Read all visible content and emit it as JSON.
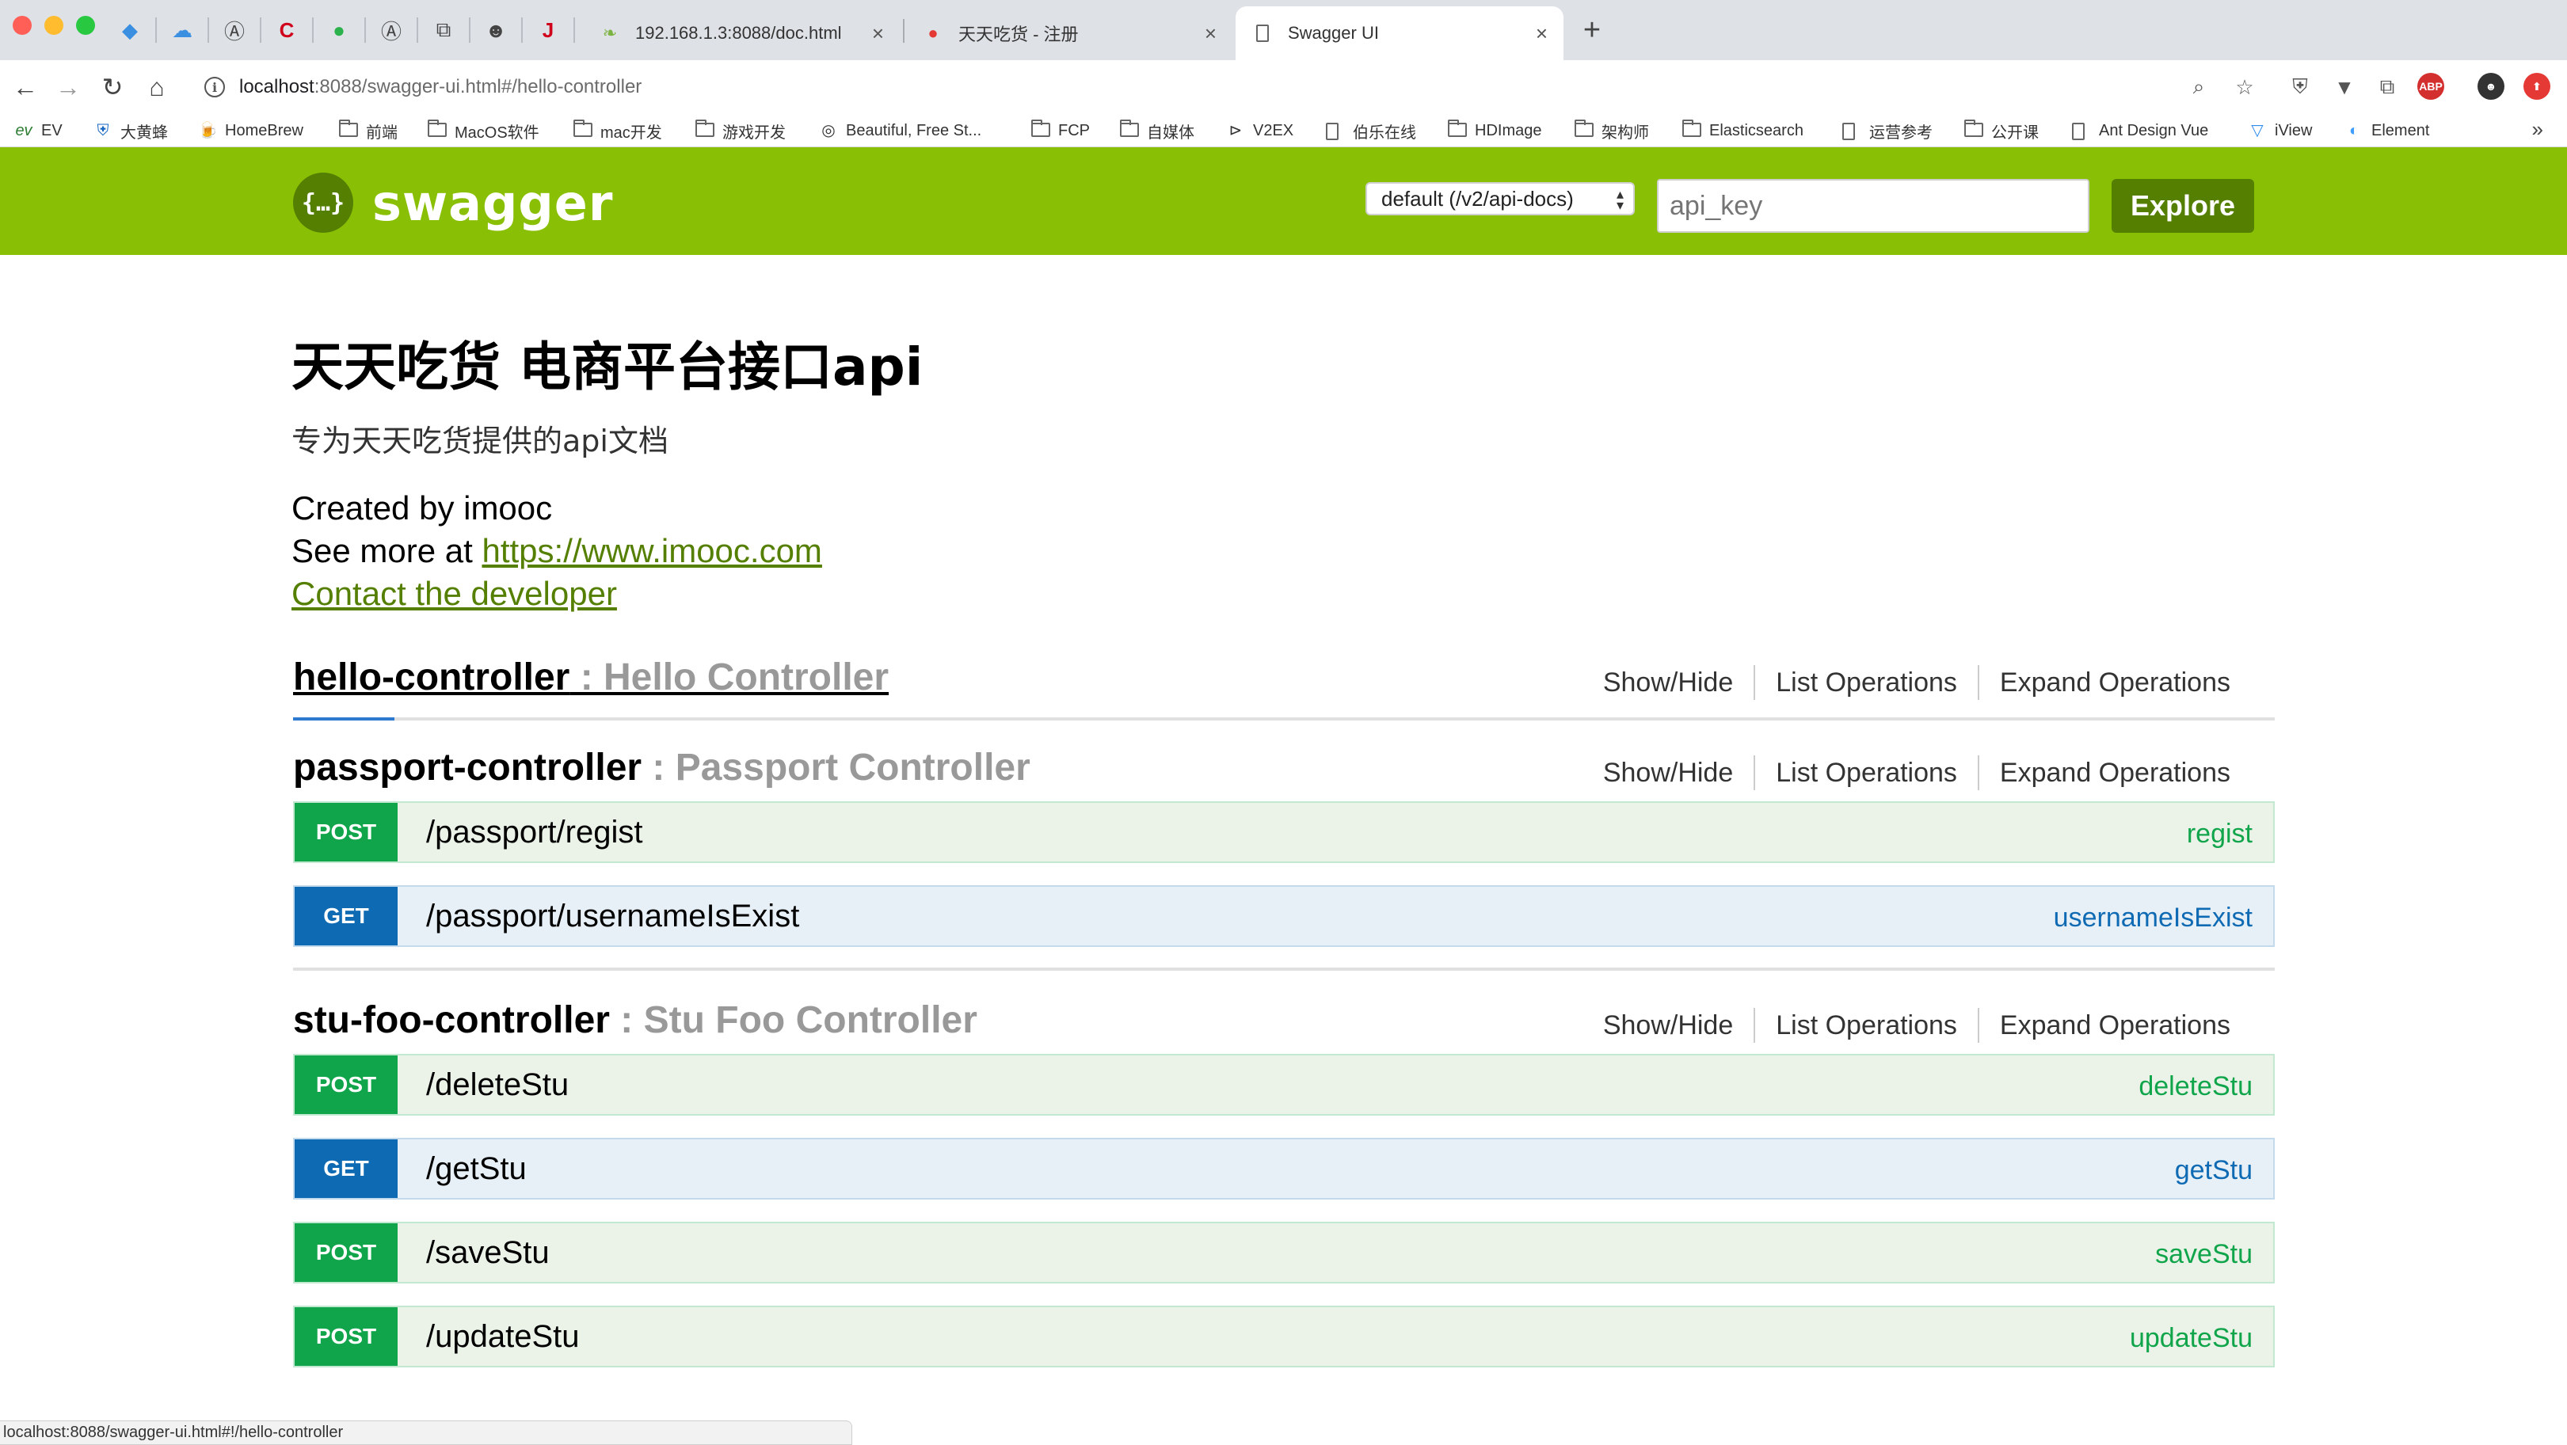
{
  "browser": {
    "tabs": [
      {
        "title": "192.168.1.3:8088/doc.html",
        "active": false
      },
      {
        "title": "天天吃货 - 注册",
        "active": false
      },
      {
        "title": "Swagger UI",
        "active": true
      }
    ],
    "url_host": "localhost",
    "url_path": ":8088/swagger-ui.html#/hello-controller",
    "bookmarks": [
      {
        "label": "EV",
        "icon": "ev-icon"
      },
      {
        "label": "大黄蜂",
        "icon": "shield-icon"
      },
      {
        "label": "HomeBrew",
        "icon": "beer-icon"
      },
      {
        "label": "前端",
        "icon": "folder-icon"
      },
      {
        "label": "MacOS软件",
        "icon": "folder-icon"
      },
      {
        "label": "mac开发",
        "icon": "folder-icon"
      },
      {
        "label": "游戏开发",
        "icon": "folder-icon"
      },
      {
        "label": "Beautiful, Free St...",
        "icon": "target-icon"
      },
      {
        "label": "FCP",
        "icon": "folder-icon"
      },
      {
        "label": "自媒体",
        "icon": "folder-icon"
      },
      {
        "label": "V2EX",
        "icon": "v2ex-icon"
      },
      {
        "label": "伯乐在线",
        "icon": "page-icon"
      },
      {
        "label": "HDImage",
        "icon": "folder-icon"
      },
      {
        "label": "架构师",
        "icon": "folder-icon"
      },
      {
        "label": "Elasticsearch",
        "icon": "folder-icon"
      },
      {
        "label": "运营参考",
        "icon": "page-icon"
      },
      {
        "label": "公开课",
        "icon": "folder-icon"
      },
      {
        "label": "Ant Design Vue",
        "icon": "page-icon"
      },
      {
        "label": "iView",
        "icon": "iview-icon"
      },
      {
        "label": "Element",
        "icon": "element-icon"
      }
    ],
    "status_url": "localhost:8088/swagger-ui.html#!/hello-controller"
  },
  "header": {
    "logo_text": "swagger",
    "spec_select": "default (/v2/api-docs)",
    "api_key_placeholder": "api_key",
    "explore_label": "Explore",
    "brand_color": "#89bf04"
  },
  "info": {
    "title": "天天吃货 电商平台接口api",
    "description": "专为天天吃货提供的api文档",
    "created_by": "Created by imooc",
    "see_more_prefix": "See more at ",
    "see_more_link": "https://www.imooc.com",
    "contact": "Contact the developer"
  },
  "actions": {
    "show_hide": "Show/Hide",
    "list_operations": "List Operations",
    "expand_operations": "Expand Operations"
  },
  "resources": [
    {
      "name": "hello-controller",
      "description": " : Hello Controller",
      "operations": []
    },
    {
      "name": "passport-controller",
      "description": " : Passport Controller",
      "operations": [
        {
          "method": "POST",
          "path": "/passport/regist",
          "nickname": "regist"
        },
        {
          "method": "GET",
          "path": "/passport/usernameIsExist",
          "nickname": "usernameIsExist"
        }
      ]
    },
    {
      "name": "stu-foo-controller",
      "description": " : Stu Foo Controller",
      "operations": [
        {
          "method": "POST",
          "path": "/deleteStu",
          "nickname": "deleteStu"
        },
        {
          "method": "GET",
          "path": "/getStu",
          "nickname": "getStu"
        },
        {
          "method": "POST",
          "path": "/saveStu",
          "nickname": "saveStu"
        },
        {
          "method": "POST",
          "path": "/updateStu",
          "nickname": "updateStu"
        }
      ]
    }
  ],
  "colors": {
    "post": "#10a54a",
    "get": "#0f6ab4",
    "link": "#547f00"
  }
}
